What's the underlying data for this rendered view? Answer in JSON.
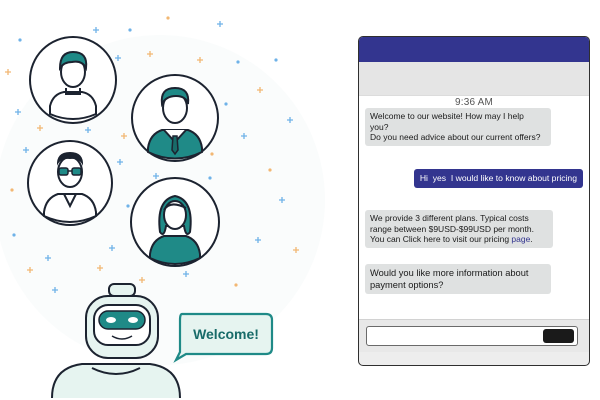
{
  "illustration": {
    "welcome_text": "Welcome!",
    "colors": {
      "teal": "#1f8a87",
      "teal_dark": "#186b69",
      "mint": "#e6f4f0",
      "sparkle_blue": "#6fb2e8",
      "sparkle_orange": "#f2b773"
    },
    "avatars": [
      "young-man-avatar",
      "businessman-avatar",
      "man-with-glasses-avatar",
      "woman-avatar"
    ]
  },
  "chat": {
    "time": "9:36 AM",
    "messages": [
      {
        "sender": "bot",
        "lines": [
          "Welcome to our website! How may I help",
          "you?",
          "Do you need advice about our current offers?"
        ]
      },
      {
        "sender": "user",
        "text": "Hi  yes  I would like to know about pricing"
      },
      {
        "sender": "bot",
        "line1": "We provide 3 different plans. Typical costs",
        "line2": "range between $9USD-$99USD per month.",
        "line3_pre": "You can Click here to visit our pricing ",
        "line3_link": "page",
        "line3_post": "."
      },
      {
        "sender": "bot",
        "lines": [
          "Would you like more information about",
          "payment options?"
        ]
      }
    ],
    "input": {
      "value": "",
      "placeholder": ""
    },
    "colors": {
      "header": "#33358f",
      "user_bubble": "#33358f",
      "bot_bubble": "#dfe1e1",
      "send_button": "#1a1a1a"
    }
  }
}
